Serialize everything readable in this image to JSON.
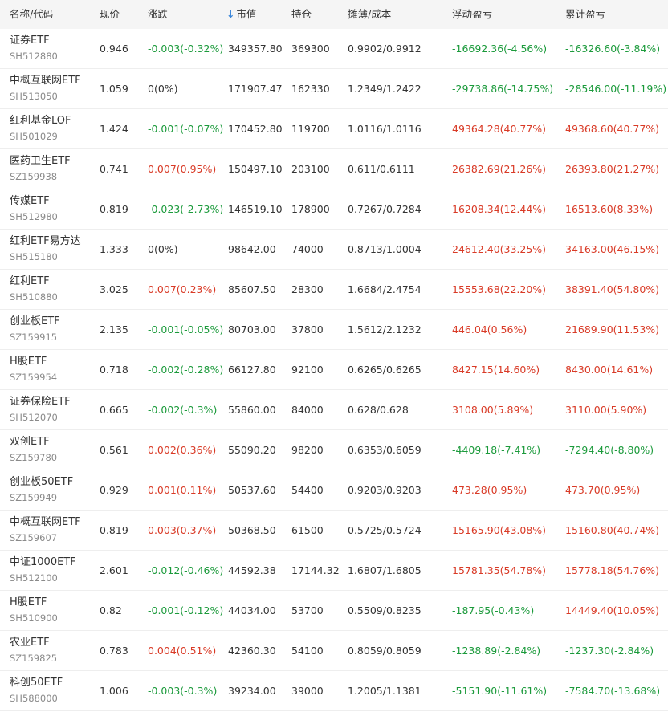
{
  "colors": {
    "up": "#d93a26",
    "down": "#1b9a3b",
    "flat": "#333333",
    "header_bg": "#f5f5f5",
    "sort_arrow": "#3a86d9"
  },
  "header": {
    "name_code": "名称/代码",
    "price": "现价",
    "change": "涨跌",
    "sort_icon": "↓",
    "sort_icon_name": "sort-down-arrow-icon",
    "market_value": "市值",
    "holding": "持仓",
    "cost": "摊薄/成本",
    "floating_pl": "浮动盈亏",
    "total_pl": "累计盈亏"
  },
  "rows": [
    {
      "name": "证券ETF",
      "code": "SH512880",
      "price": "0.946",
      "change": "-0.003(-0.32%)",
      "change_dir": "down",
      "market_value": "349357.80",
      "holding": "369300",
      "cost": "0.9902/0.9912",
      "floating_pl": "-16692.36(-4.56%)",
      "floating_dir": "down",
      "total_pl": "-16326.60(-3.84%)",
      "total_dir": "down"
    },
    {
      "name": "中概互联网ETF",
      "code": "SH513050",
      "price": "1.059",
      "change": "0(0%)",
      "change_dir": "flat",
      "market_value": "171907.47",
      "holding": "162330",
      "cost": "1.2349/1.2422",
      "floating_pl": "-29738.86(-14.75%)",
      "floating_dir": "down",
      "total_pl": "-28546.00(-11.19%)",
      "total_dir": "down"
    },
    {
      "name": "红利基金LOF",
      "code": "SH501029",
      "price": "1.424",
      "change": "-0.001(-0.07%)",
      "change_dir": "down",
      "market_value": "170452.80",
      "holding": "119700",
      "cost": "1.0116/1.0116",
      "floating_pl": "49364.28(40.77%)",
      "floating_dir": "up",
      "total_pl": "49368.60(40.77%)",
      "total_dir": "up"
    },
    {
      "name": "医药卫生ETF",
      "code": "SZ159938",
      "price": "0.741",
      "change": "0.007(0.95%)",
      "change_dir": "up",
      "market_value": "150497.10",
      "holding": "203100",
      "cost": "0.611/0.6111",
      "floating_pl": "26382.69(21.26%)",
      "floating_dir": "up",
      "total_pl": "26393.80(21.27%)",
      "total_dir": "up"
    },
    {
      "name": "传媒ETF",
      "code": "SH512980",
      "price": "0.819",
      "change": "-0.023(-2.73%)",
      "change_dir": "down",
      "market_value": "146519.10",
      "holding": "178900",
      "cost": "0.7267/0.7284",
      "floating_pl": "16208.34(12.44%)",
      "floating_dir": "up",
      "total_pl": "16513.60(8.33%)",
      "total_dir": "up"
    },
    {
      "name": "红利ETF易方达",
      "code": "SH515180",
      "price": "1.333",
      "change": "0(0%)",
      "change_dir": "flat",
      "market_value": "98642.00",
      "holding": "74000",
      "cost": "0.8713/1.0004",
      "floating_pl": "24612.40(33.25%)",
      "floating_dir": "up",
      "total_pl": "34163.00(46.15%)",
      "total_dir": "up"
    },
    {
      "name": "红利ETF",
      "code": "SH510880",
      "price": "3.025",
      "change": "0.007(0.23%)",
      "change_dir": "up",
      "market_value": "85607.50",
      "holding": "28300",
      "cost": "1.6684/2.4754",
      "floating_pl": "15553.68(22.20%)",
      "floating_dir": "up",
      "total_pl": "38391.40(54.80%)",
      "total_dir": "up"
    },
    {
      "name": "创业板ETF",
      "code": "SZ159915",
      "price": "2.135",
      "change": "-0.001(-0.05%)",
      "change_dir": "down",
      "market_value": "80703.00",
      "holding": "37800",
      "cost": "1.5612/2.1232",
      "floating_pl": "446.04(0.56%)",
      "floating_dir": "up",
      "total_pl": "21689.90(11.53%)",
      "total_dir": "up"
    },
    {
      "name": "H股ETF",
      "code": "SZ159954",
      "price": "0.718",
      "change": "-0.002(-0.28%)",
      "change_dir": "down",
      "market_value": "66127.80",
      "holding": "92100",
      "cost": "0.6265/0.6265",
      "floating_pl": "8427.15(14.60%)",
      "floating_dir": "up",
      "total_pl": "8430.00(14.61%)",
      "total_dir": "up"
    },
    {
      "name": "证券保险ETF",
      "code": "SH512070",
      "price": "0.665",
      "change": "-0.002(-0.3%)",
      "change_dir": "down",
      "market_value": "55860.00",
      "holding": "84000",
      "cost": "0.628/0.628",
      "floating_pl": "3108.00(5.89%)",
      "floating_dir": "up",
      "total_pl": "3110.00(5.90%)",
      "total_dir": "up"
    },
    {
      "name": "双创ETF",
      "code": "SZ159780",
      "price": "0.561",
      "change": "0.002(0.36%)",
      "change_dir": "up",
      "market_value": "55090.20",
      "holding": "98200",
      "cost": "0.6353/0.6059",
      "floating_pl": "-4409.18(-7.41%)",
      "floating_dir": "down",
      "total_pl": "-7294.40(-8.80%)",
      "total_dir": "down"
    },
    {
      "name": "创业板50ETF",
      "code": "SZ159949",
      "price": "0.929",
      "change": "0.001(0.11%)",
      "change_dir": "up",
      "market_value": "50537.60",
      "holding": "54400",
      "cost": "0.9203/0.9203",
      "floating_pl": "473.28(0.95%)",
      "floating_dir": "up",
      "total_pl": "473.70(0.95%)",
      "total_dir": "up"
    },
    {
      "name": "中概互联网ETF",
      "code": "SZ159607",
      "price": "0.819",
      "change": "0.003(0.37%)",
      "change_dir": "up",
      "market_value": "50368.50",
      "holding": "61500",
      "cost": "0.5725/0.5724",
      "floating_pl": "15165.90(43.08%)",
      "floating_dir": "up",
      "total_pl": "15160.80(40.74%)",
      "total_dir": "up"
    },
    {
      "name": "中证1000ETF",
      "code": "SH512100",
      "price": "2.601",
      "change": "-0.012(-0.46%)",
      "change_dir": "down",
      "market_value": "44592.38",
      "holding": "17144.32",
      "cost": "1.6807/1.6805",
      "floating_pl": "15781.35(54.78%)",
      "floating_dir": "up",
      "total_pl": "15778.18(54.76%)",
      "total_dir": "up"
    },
    {
      "name": "H股ETF",
      "code": "SH510900",
      "price": "0.82",
      "change": "-0.001(-0.12%)",
      "change_dir": "down",
      "market_value": "44034.00",
      "holding": "53700",
      "cost": "0.5509/0.8235",
      "floating_pl": "-187.95(-0.43%)",
      "floating_dir": "down",
      "total_pl": "14449.40(10.05%)",
      "total_dir": "up"
    },
    {
      "name": "农业ETF",
      "code": "SZ159825",
      "price": "0.783",
      "change": "0.004(0.51%)",
      "change_dir": "up",
      "market_value": "42360.30",
      "holding": "54100",
      "cost": "0.8059/0.8059",
      "floating_pl": "-1238.89(-2.84%)",
      "floating_dir": "down",
      "total_pl": "-1237.30(-2.84%)",
      "total_dir": "down"
    },
    {
      "name": "科创50ETF",
      "code": "SH588000",
      "price": "1.006",
      "change": "-0.003(-0.3%)",
      "change_dir": "down",
      "market_value": "39234.00",
      "holding": "39000",
      "cost": "1.2005/1.1381",
      "floating_pl": "-5151.90(-11.61%)",
      "floating_dir": "down",
      "total_pl": "-7584.70(-13.68%)",
      "total_dir": "down"
    }
  ]
}
